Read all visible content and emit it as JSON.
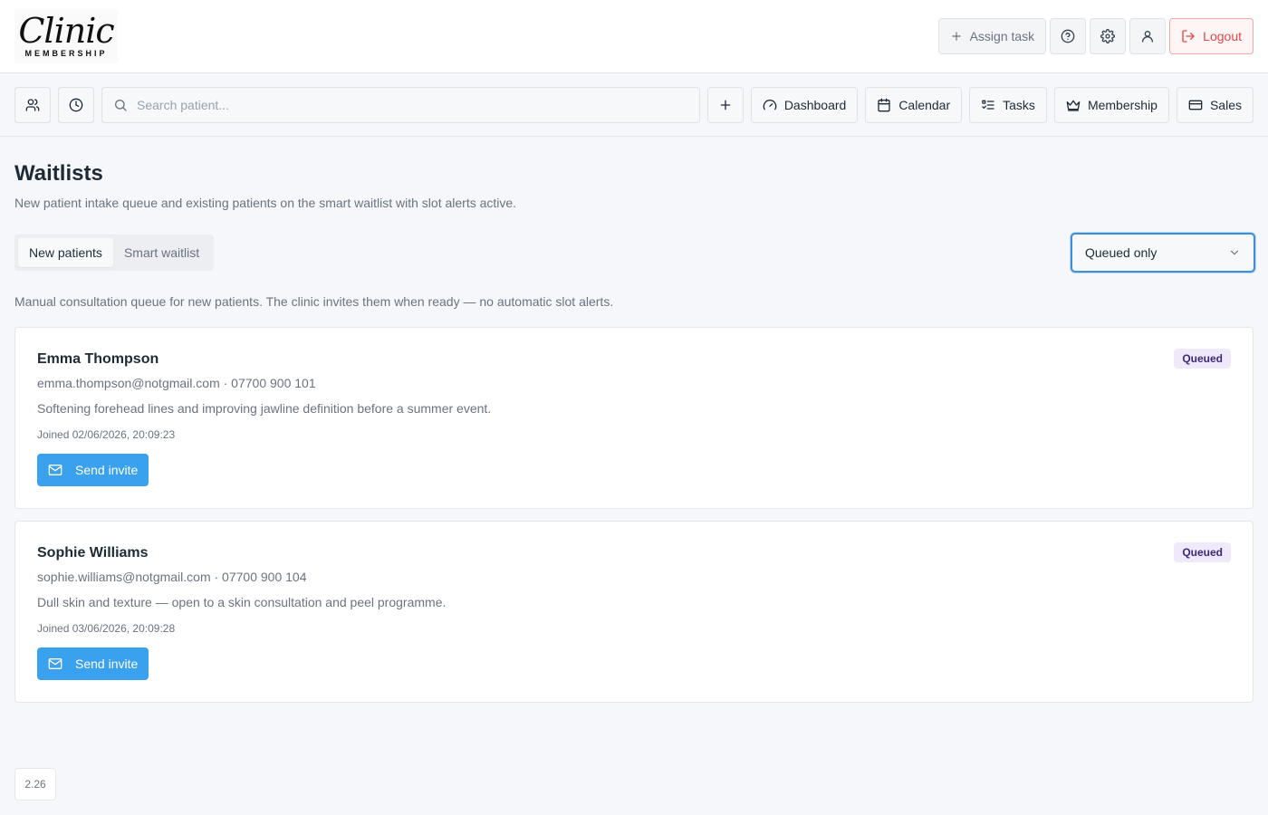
{
  "app": {
    "logo_script": "Clinic",
    "logo_sub": "MEMBERSHIP"
  },
  "topbar": {
    "assign_task": "Assign task",
    "logout": "Logout"
  },
  "navbar": {
    "search_placeholder": "Search patient...",
    "items": [
      {
        "label": "Dashboard",
        "icon": "gauge-icon"
      },
      {
        "label": "Calendar",
        "icon": "calendar-icon"
      },
      {
        "label": "Tasks",
        "icon": "list-checks-icon"
      },
      {
        "label": "Membership",
        "icon": "crown-icon"
      },
      {
        "label": "Sales",
        "icon": "credit-card-icon"
      }
    ]
  },
  "page": {
    "title": "Waitlists",
    "subtitle": "New patient intake queue and existing patients on the smart waitlist with slot alerts active."
  },
  "tabs": [
    {
      "label": "New patients",
      "active": true
    },
    {
      "label": "Smart waitlist",
      "active": false
    }
  ],
  "filter": {
    "selected": "Queued only"
  },
  "section_note": "Manual consultation queue for new patients. The clinic invites them when ready — no automatic slot alerts.",
  "patients": [
    {
      "name": "Emma Thompson",
      "contact": "emma.thompson@notgmail.com · 07700 900 101",
      "note": "Softening forehead lines and improving jawline definition before a summer event.",
      "joined": "Joined 02/06/2026, 20:09:23",
      "status": "Queued",
      "action": "Send invite"
    },
    {
      "name": "Sophie Williams",
      "contact": "sophie.williams@notgmail.com · 07700 900 104",
      "note": "Dull skin and texture — open to a skin consultation and peel programme.",
      "joined": "Joined 03/06/2026, 20:09:28",
      "status": "Queued",
      "action": "Send invite"
    }
  ],
  "version": "2.26",
  "colors": {
    "accent": "#3aa1ee",
    "logout": "#e04848",
    "badge_bg": "#efe9fb",
    "badge_text": "#3b2a7a",
    "focus_ring": "#3b8fd6"
  }
}
